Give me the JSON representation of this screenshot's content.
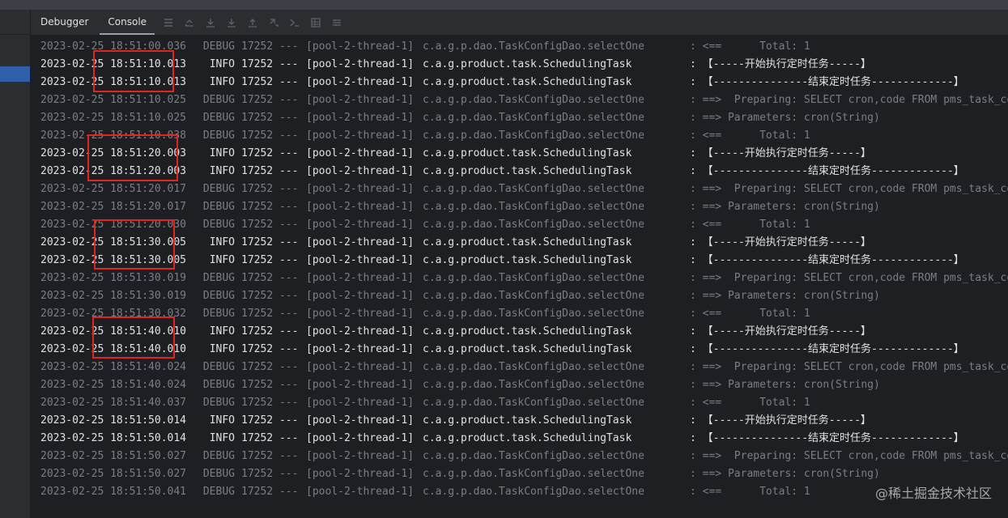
{
  "tabs": [
    {
      "label": "Debugger",
      "active": false
    },
    {
      "label": "Console",
      "active": true
    }
  ],
  "toolbar_icons": [
    "menu-icon",
    "scroll-up-icon",
    "step-over-icon",
    "step-into-icon",
    "step-out-icon",
    "rerun-icon",
    "run-to-cursor-icon",
    "table-icon",
    "settings-icon"
  ],
  "colors": {
    "info_text": "#dfe1e5",
    "debug_text": "#7a7e85",
    "highlight_box": "#e0271f",
    "console_bg": "#1e1f22"
  },
  "log": [
    {
      "ts": "2023-02-25 18:51:00.036",
      "level": "DEBUG",
      "pid": "17252",
      "sep": "---",
      "thread": "[pool-2-thread-1]",
      "logger": "c.a.g.p.dao.TaskConfigDao.selectOne",
      "msg": ": <==      Total: 1"
    },
    {
      "ts": "2023-02-25 18:51:10.013",
      "level": "INFO",
      "pid": "17252",
      "sep": "---",
      "thread": "[pool-2-thread-1]",
      "logger": "c.a.g.product.task.SchedulingTask",
      "msg": ": 【-----开始执行定时任务-----】"
    },
    {
      "ts": "2023-02-25 18:51:10.013",
      "level": "INFO",
      "pid": "17252",
      "sep": "---",
      "thread": "[pool-2-thread-1]",
      "logger": "c.a.g.product.task.SchedulingTask",
      "msg": ": 【---------------结束定时任务-------------】"
    },
    {
      "ts": "2023-02-25 18:51:10.025",
      "level": "DEBUG",
      "pid": "17252",
      "sep": "---",
      "thread": "[pool-2-thread-1]",
      "logger": "c.a.g.p.dao.TaskConfigDao.selectOne",
      "msg": ": ==>  Preparing: SELECT cron,code FROM pms_task_co"
    },
    {
      "ts": "2023-02-25 18:51:10.025",
      "level": "DEBUG",
      "pid": "17252",
      "sep": "---",
      "thread": "[pool-2-thread-1]",
      "logger": "c.a.g.p.dao.TaskConfigDao.selectOne",
      "msg": ": ==> Parameters: cron(String)"
    },
    {
      "ts": "2023-02-25 18:51:10.038",
      "level": "DEBUG",
      "pid": "17252",
      "sep": "---",
      "thread": "[pool-2-thread-1]",
      "logger": "c.a.g.p.dao.TaskConfigDao.selectOne",
      "msg": ": <==      Total: 1"
    },
    {
      "ts": "2023-02-25 18:51:20.003",
      "level": "INFO",
      "pid": "17252",
      "sep": "---",
      "thread": "[pool-2-thread-1]",
      "logger": "c.a.g.product.task.SchedulingTask",
      "msg": ": 【-----开始执行定时任务-----】"
    },
    {
      "ts": "2023-02-25 18:51:20.003",
      "level": "INFO",
      "pid": "17252",
      "sep": "---",
      "thread": "[pool-2-thread-1]",
      "logger": "c.a.g.product.task.SchedulingTask",
      "msg": ": 【---------------结束定时任务-------------】"
    },
    {
      "ts": "2023-02-25 18:51:20.017",
      "level": "DEBUG",
      "pid": "17252",
      "sep": "---",
      "thread": "[pool-2-thread-1]",
      "logger": "c.a.g.p.dao.TaskConfigDao.selectOne",
      "msg": ": ==>  Preparing: SELECT cron,code FROM pms_task_co"
    },
    {
      "ts": "2023-02-25 18:51:20.017",
      "level": "DEBUG",
      "pid": "17252",
      "sep": "---",
      "thread": "[pool-2-thread-1]",
      "logger": "c.a.g.p.dao.TaskConfigDao.selectOne",
      "msg": ": ==> Parameters: cron(String)"
    },
    {
      "ts": "2023-02-25 18:51:20.030",
      "level": "DEBUG",
      "pid": "17252",
      "sep": "---",
      "thread": "[pool-2-thread-1]",
      "logger": "c.a.g.p.dao.TaskConfigDao.selectOne",
      "msg": ": <==      Total: 1"
    },
    {
      "ts": "2023-02-25 18:51:30.005",
      "level": "INFO",
      "pid": "17252",
      "sep": "---",
      "thread": "[pool-2-thread-1]",
      "logger": "c.a.g.product.task.SchedulingTask",
      "msg": ": 【-----开始执行定时任务-----】"
    },
    {
      "ts": "2023-02-25 18:51:30.005",
      "level": "INFO",
      "pid": "17252",
      "sep": "---",
      "thread": "[pool-2-thread-1]",
      "logger": "c.a.g.product.task.SchedulingTask",
      "msg": ": 【---------------结束定时任务-------------】"
    },
    {
      "ts": "2023-02-25 18:51:30.019",
      "level": "DEBUG",
      "pid": "17252",
      "sep": "---",
      "thread": "[pool-2-thread-1]",
      "logger": "c.a.g.p.dao.TaskConfigDao.selectOne",
      "msg": ": ==>  Preparing: SELECT cron,code FROM pms_task_co"
    },
    {
      "ts": "2023-02-25 18:51:30.019",
      "level": "DEBUG",
      "pid": "17252",
      "sep": "---",
      "thread": "[pool-2-thread-1]",
      "logger": "c.a.g.p.dao.TaskConfigDao.selectOne",
      "msg": ": ==> Parameters: cron(String)"
    },
    {
      "ts": "2023-02-25 18:51:30.032",
      "level": "DEBUG",
      "pid": "17252",
      "sep": "---",
      "thread": "[pool-2-thread-1]",
      "logger": "c.a.g.p.dao.TaskConfigDao.selectOne",
      "msg": ": <==      Total: 1"
    },
    {
      "ts": "2023-02-25 18:51:40.010",
      "level": "INFO",
      "pid": "17252",
      "sep": "---",
      "thread": "[pool-2-thread-1]",
      "logger": "c.a.g.product.task.SchedulingTask",
      "msg": ": 【-----开始执行定时任务-----】"
    },
    {
      "ts": "2023-02-25 18:51:40.010",
      "level": "INFO",
      "pid": "17252",
      "sep": "---",
      "thread": "[pool-2-thread-1]",
      "logger": "c.a.g.product.task.SchedulingTask",
      "msg": ": 【---------------结束定时任务-------------】"
    },
    {
      "ts": "2023-02-25 18:51:40.024",
      "level": "DEBUG",
      "pid": "17252",
      "sep": "---",
      "thread": "[pool-2-thread-1]",
      "logger": "c.a.g.p.dao.TaskConfigDao.selectOne",
      "msg": ": ==>  Preparing: SELECT cron,code FROM pms_task_co"
    },
    {
      "ts": "2023-02-25 18:51:40.024",
      "level": "DEBUG",
      "pid": "17252",
      "sep": "---",
      "thread": "[pool-2-thread-1]",
      "logger": "c.a.g.p.dao.TaskConfigDao.selectOne",
      "msg": ": ==> Parameters: cron(String)"
    },
    {
      "ts": "2023-02-25 18:51:40.037",
      "level": "DEBUG",
      "pid": "17252",
      "sep": "---",
      "thread": "[pool-2-thread-1]",
      "logger": "c.a.g.p.dao.TaskConfigDao.selectOne",
      "msg": ": <==      Total: 1"
    },
    {
      "ts": "2023-02-25 18:51:50.014",
      "level": "INFO",
      "pid": "17252",
      "sep": "---",
      "thread": "[pool-2-thread-1]",
      "logger": "c.a.g.product.task.SchedulingTask",
      "msg": ": 【-----开始执行定时任务-----】"
    },
    {
      "ts": "2023-02-25 18:51:50.014",
      "level": "INFO",
      "pid": "17252",
      "sep": "---",
      "thread": "[pool-2-thread-1]",
      "logger": "c.a.g.product.task.SchedulingTask",
      "msg": ": 【---------------结束定时任务-------------】"
    },
    {
      "ts": "2023-02-25 18:51:50.027",
      "level": "DEBUG",
      "pid": "17252",
      "sep": "---",
      "thread": "[pool-2-thread-1]",
      "logger": "c.a.g.p.dao.TaskConfigDao.selectOne",
      "msg": ": ==>  Preparing: SELECT cron,code FROM pms_task_co"
    },
    {
      "ts": "2023-02-25 18:51:50.027",
      "level": "DEBUG",
      "pid": "17252",
      "sep": "---",
      "thread": "[pool-2-thread-1]",
      "logger": "c.a.g.p.dao.TaskConfigDao.selectOne",
      "msg": ": ==> Parameters: cron(String)"
    },
    {
      "ts": "2023-02-25 18:51:50.041",
      "level": "DEBUG",
      "pid": "17252",
      "sep": "---",
      "thread": "[pool-2-thread-1]",
      "logger": "c.a.g.p.dao.TaskConfigDao.selectOne",
      "msg": ": <==      Total: 1"
    }
  ],
  "watermark": "@稀土掘金技术社区"
}
